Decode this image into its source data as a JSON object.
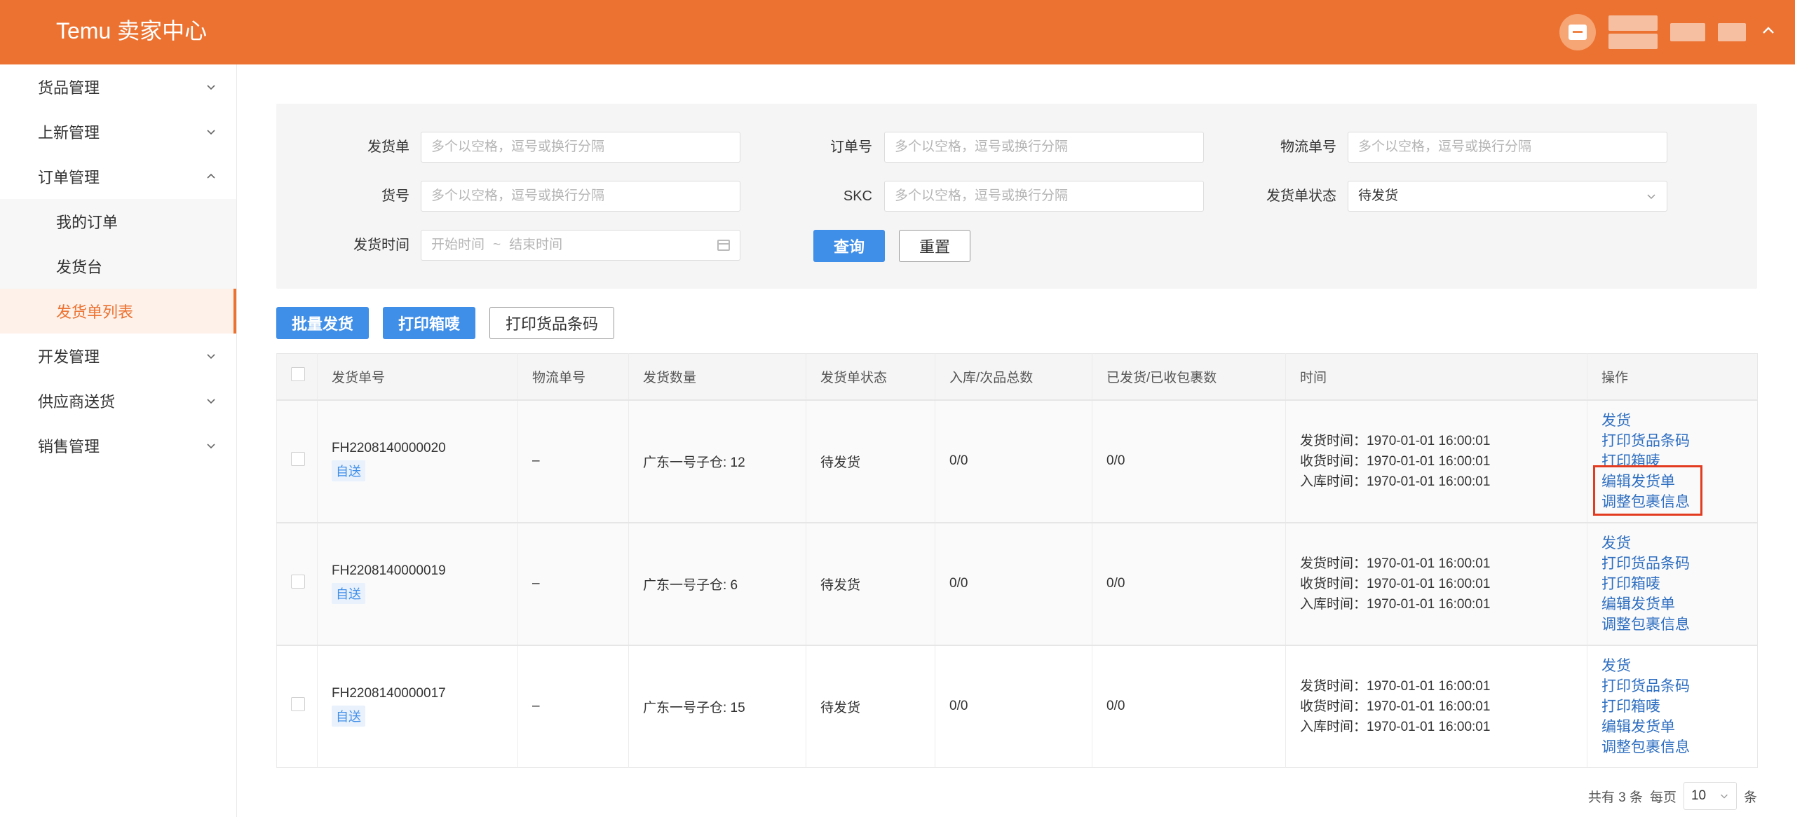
{
  "header": {
    "brand": "Temu 卖家中心"
  },
  "sidebar": {
    "items": [
      {
        "label": "货品管理",
        "expanded": false
      },
      {
        "label": "上新管理",
        "expanded": false
      },
      {
        "label": "订单管理",
        "expanded": true,
        "children": [
          "我的订单",
          "发货台",
          "发货单列表"
        ],
        "active_child": "发货单列表"
      },
      {
        "label": "开发管理",
        "expanded": false
      },
      {
        "label": "供应商送货",
        "expanded": false
      },
      {
        "label": "销售管理",
        "expanded": false
      }
    ]
  },
  "filters": {
    "shipment_no": {
      "label": "发货单",
      "placeholder": "多个以空格，逗号或换行分隔"
    },
    "order_no": {
      "label": "订单号",
      "placeholder": "多个以空格，逗号或换行分隔"
    },
    "logistics_no": {
      "label": "物流单号",
      "placeholder": "多个以空格，逗号或换行分隔"
    },
    "item_no": {
      "label": "货号",
      "placeholder": "多个以空格，逗号或换行分隔"
    },
    "skc": {
      "label": "SKC",
      "placeholder": "多个以空格，逗号或换行分隔"
    },
    "status": {
      "label": "发货单状态",
      "value": "待发货"
    },
    "ship_time": {
      "label": "发货时间",
      "start_placeholder": "开始时间",
      "separator": "~",
      "end_placeholder": "结束时间"
    },
    "query_label": "查询",
    "reset_label": "重置"
  },
  "actions": {
    "batch_ship": "批量发货",
    "print_box_label": "打印箱唛",
    "print_barcode": "打印货品条码"
  },
  "table": {
    "columns": [
      "发货单号",
      "物流单号",
      "发货数量",
      "发货单状态",
      "入库/次品总数",
      "已发货/已收包裹数",
      "时间",
      "操作"
    ],
    "rows": [
      {
        "shipment_no": "FH2208140000020",
        "tag": "自送",
        "logistics_no": "–",
        "quantity": "广东一号子仓: 12",
        "status": "待发货",
        "inbound_defect": "0/0",
        "shipped_received": "0/0",
        "ship_time": "发货时间：1970-01-01 16:00:01",
        "receive_time": "收货时间：1970-01-01 16:00:01",
        "inbound_time": "入库时间：1970-01-01 16:00:01"
      },
      {
        "shipment_no": "FH2208140000019",
        "tag": "自送",
        "logistics_no": "–",
        "quantity": "广东一号子仓: 6",
        "status": "待发货",
        "inbound_defect": "0/0",
        "shipped_received": "0/0",
        "ship_time": "发货时间：1970-01-01 16:00:01",
        "receive_time": "收货时间：1970-01-01 16:00:01",
        "inbound_time": "入库时间：1970-01-01 16:00:01"
      },
      {
        "shipment_no": "FH2208140000017",
        "tag": "自送",
        "logistics_no": "–",
        "quantity": "广东一号子仓: 15",
        "status": "待发货",
        "inbound_defect": "0/0",
        "shipped_received": "0/0",
        "ship_time": "发货时间：1970-01-01 16:00:01",
        "receive_time": "收货时间：1970-01-01 16:00:01",
        "inbound_time": "入库时间：1970-01-01 16:00:01"
      }
    ],
    "operations": [
      "发货",
      "打印货品条码",
      "打印箱唛",
      "编辑发货单",
      "调整包裹信息"
    ]
  },
  "pagination": {
    "total_text": "共有 3 条",
    "per_page_label": "每页",
    "page_size": "10",
    "unit": "条"
  },
  "colors": {
    "brand": "#ec7231",
    "primary": "#3f8ee8",
    "link": "#2f6fc1",
    "highlight": "#e23b1f"
  }
}
